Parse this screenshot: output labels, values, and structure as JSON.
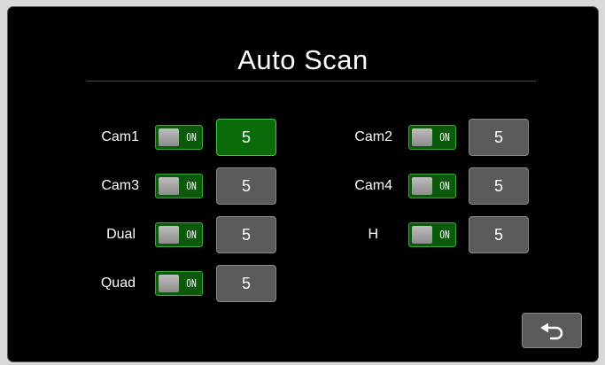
{
  "title": "Auto Scan",
  "toggle_state_text": "ON",
  "left_column": [
    {
      "label": "Cam1",
      "toggle": "ON",
      "value": "5",
      "selected": true
    },
    {
      "label": "Cam3",
      "toggle": "ON",
      "value": "5",
      "selected": false
    },
    {
      "label": "Dual",
      "toggle": "ON",
      "value": "5",
      "selected": false
    },
    {
      "label": "Quad",
      "toggle": "ON",
      "value": "5",
      "selected": false
    }
  ],
  "right_column": [
    {
      "label": "Cam2",
      "toggle": "ON",
      "value": "5",
      "selected": false
    },
    {
      "label": "Cam4",
      "toggle": "ON",
      "value": "5",
      "selected": false
    },
    {
      "label": "H",
      "toggle": "ON",
      "value": "5",
      "selected": false
    }
  ],
  "back_button": {
    "icon": "return-arrow-icon"
  },
  "colors": {
    "background": "#000000",
    "toggle_on": "#0b5a0b",
    "selected_value": "#0b6b0b",
    "value_button": "#5a5a5a"
  }
}
